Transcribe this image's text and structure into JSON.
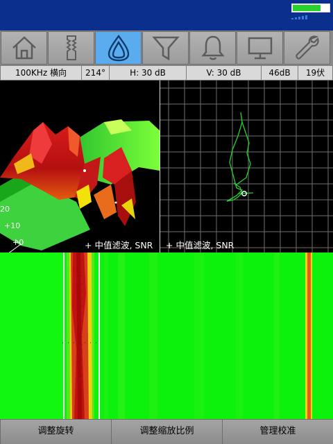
{
  "toolbar": {
    "tools": [
      {
        "icon": "home-icon"
      },
      {
        "icon": "probe-icon"
      },
      {
        "icon": "drop-icon",
        "active": true
      },
      {
        "icon": "filter-icon"
      },
      {
        "icon": "bell-icon"
      },
      {
        "icon": "monitor-icon"
      },
      {
        "icon": "wrench-icon"
      }
    ],
    "active_color": "#5aacef"
  },
  "status": {
    "battery_level": 0.8
  },
  "info": {
    "frequency": "100KHz 横向",
    "angle": "214°",
    "h_gain": "H: 30 dB",
    "v_gain": "V: 30 dB",
    "total_gain": "46dB",
    "voltage": "19伏"
  },
  "plot3d": {
    "axis_labels": [
      "20",
      "+10",
      "+0"
    ],
    "caption": "+ 中值滤波, SNR"
  },
  "plot2d": {
    "caption": "+ 中值滤波, SNR"
  },
  "bottom": {
    "rotate": "调整旋转",
    "scale": "调整缩放比例",
    "calibrate": "管理校准"
  }
}
